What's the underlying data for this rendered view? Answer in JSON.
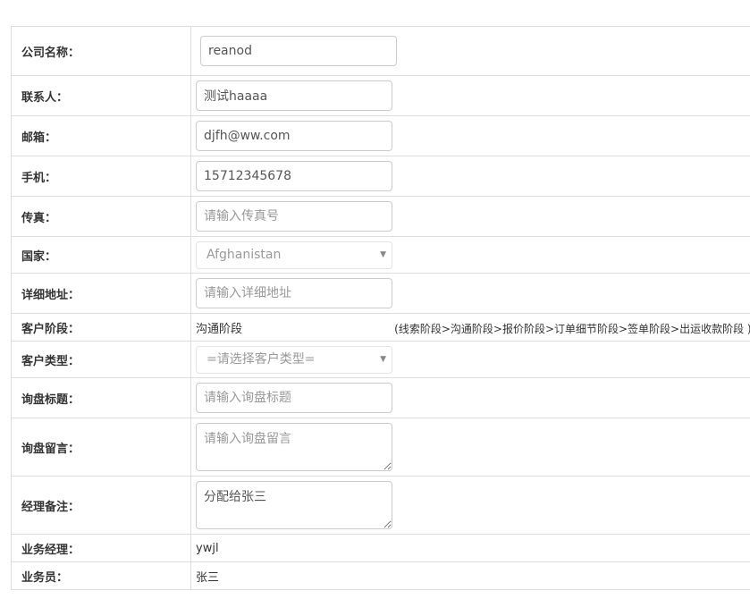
{
  "form": {
    "company": {
      "label": "公司名称：",
      "value": "reanod",
      "placeholder": ""
    },
    "contact": {
      "label": "联系人：",
      "value": "测试haaaa",
      "placeholder": ""
    },
    "email": {
      "label": "邮箱：",
      "value": "djfh@ww.com",
      "placeholder": ""
    },
    "mobile": {
      "label": "手机：",
      "value": "15712345678",
      "placeholder": ""
    },
    "fax": {
      "label": "传真：",
      "value": "",
      "placeholder": "请输入传真号"
    },
    "country": {
      "label": "国家：",
      "selected": "Afghanistan"
    },
    "address": {
      "label": "详细地址：",
      "value": "",
      "placeholder": "请输入详细地址"
    },
    "stage": {
      "label": "客户阶段：",
      "value": "沟通阶段",
      "flow": "(线索阶段>沟通阶段>报价阶段>订单细节阶段>签单阶段>出运收款阶段 )"
    },
    "customer_type": {
      "label": "客户类型：",
      "selected": "=请选择客户类型="
    },
    "inquiry_title": {
      "label": "询盘标题：",
      "value": "",
      "placeholder": "请输入询盘标题"
    },
    "inquiry_message": {
      "label": "询盘留言：",
      "value": "",
      "placeholder": "请输入询盘留言"
    },
    "manager_note": {
      "label": "经理备注：",
      "value": "分配给张三",
      "placeholder": ""
    },
    "sales_manager": {
      "label": "业务经理：",
      "value": "ywjl"
    },
    "salesperson": {
      "label": "业务员：",
      "value": "张三"
    }
  }
}
